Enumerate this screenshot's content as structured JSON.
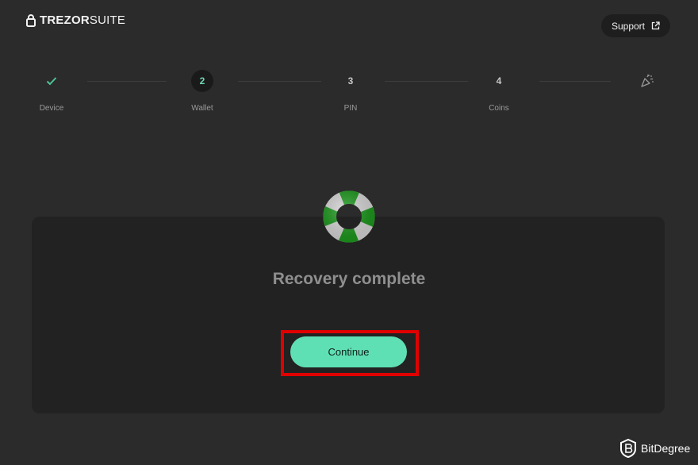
{
  "app": {
    "logo_bold": "TREZOR",
    "logo_light": "SUITE"
  },
  "header": {
    "support_label": "Support"
  },
  "stepper": {
    "steps": [
      {
        "marker": "",
        "label": "Device",
        "state": "done"
      },
      {
        "marker": "2",
        "label": "Wallet",
        "state": "active"
      },
      {
        "marker": "3",
        "label": "PIN",
        "state": "pending"
      },
      {
        "marker": "4",
        "label": "Coins",
        "state": "pending"
      }
    ],
    "final_icon": "party-popper-icon"
  },
  "main": {
    "title": "Recovery complete",
    "continue_label": "Continue",
    "illustration": "lifebuoy-icon"
  },
  "watermark": {
    "text": "BitDegree"
  },
  "colors": {
    "background": "#2b2b2b",
    "card": "#222222",
    "accent": "#5ee0b4",
    "highlight": "#e00000",
    "buoy_green": "#1f9a1f"
  }
}
